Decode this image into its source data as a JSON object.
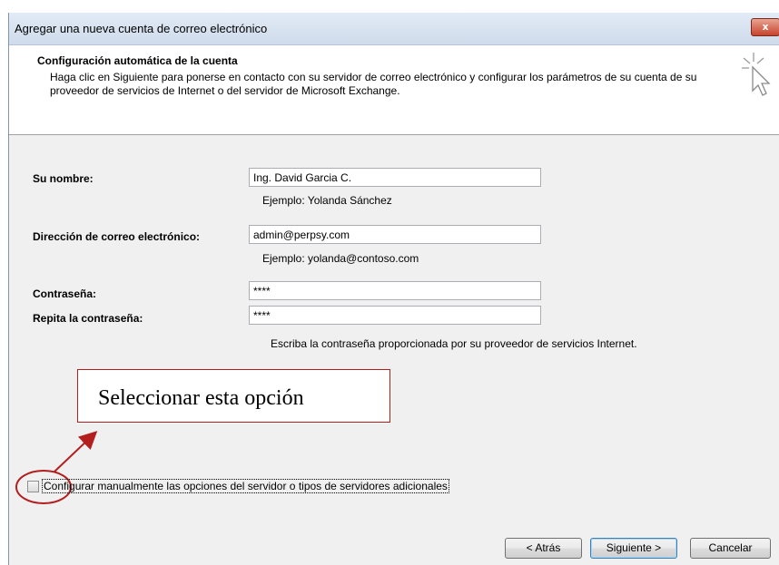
{
  "window": {
    "title": "Agregar una nueva cuenta de correo electrónico",
    "close_label": "x"
  },
  "header": {
    "title": "Configuración automática de la cuenta",
    "description": "Haga clic en Siguiente para ponerse en contacto con su servidor de correo electrónico y configurar los parámetros de su cuenta de su proveedor de servicios de Internet o del servidor de Microsoft Exchange.",
    "icon": "cursor-sparkle-icon"
  },
  "form": {
    "name_label": "Su nombre:",
    "name_value": "Ing. David Garcia C.",
    "name_hint": "Ejemplo: Yolanda Sánchez",
    "email_label": "Dirección de correo electrónico:",
    "email_value": "admin@perpsy.com",
    "email_hint": "Ejemplo: yolanda@contoso.com",
    "password_label": "Contraseña:",
    "password_value": "****",
    "repeat_label": "Repita la contraseña:",
    "repeat_value": "****",
    "password_hint": "Escriba la contraseña proporcionada por su proveedor de servicios Internet."
  },
  "annotation": {
    "callout_text": "Seleccionar esta opción",
    "color": "#b31f1f"
  },
  "manual_option": {
    "label": "Configurar manualmente las opciones del servidor o tipos de servidores adicionales",
    "checked": false
  },
  "buttons": {
    "back": "< Atrás",
    "next": "Siguiente >",
    "cancel": "Cancelar"
  }
}
